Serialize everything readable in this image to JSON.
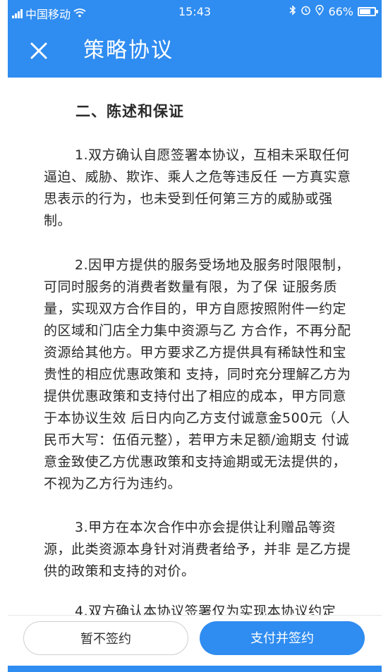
{
  "status_bar": {
    "carrier": "中国移动",
    "time": "15:43",
    "battery": "66%",
    "battery_level": 0.66,
    "icons": [
      "signal-icon",
      "wifi-icon",
      "bluetooth-icon",
      "alarm-icon",
      "location-icon",
      "battery-icon"
    ]
  },
  "nav": {
    "title": "策略协议",
    "close_icon": "close-icon"
  },
  "content": {
    "section_title": "二、陈述和保证",
    "paragraphs": [
      "1.双方确认自愿签署本协议，互相未采取任何逼迫、威胁、欺诈、乘人之危等违反任 一方真实意思表示的行为，也未受到任何第三方的威胁或强制。",
      "2.因甲方提供的服务受场地及服务时限限制，可同时服务的消费者数量有限，为了保 证服务质量，实现双方合作目的，甲方自愿按照附件一约定的区域和门店全力集中资源与乙 方合作，不再分配资源给其他方。甲方要求乙方提供具有稀缺性和宝贵性的相应优惠政策和 支持，同时充分理解乙方为提供优惠政策和支持付出了相应的成本，甲方同意于本协议生效 后日内向乙方支付诚意金500元（人民币大写：伍佰元整），若甲方未足额/逾期支 付诚意金致使乙方优惠政策和支持逾期或无法提供的，不视为乙方行为违约。",
      "3.甲方在本次合作中亦会提供让利赠品等资源，此类资源本身针对消费者给予，并非 是乙方提供的政策和支持的对价。",
      "4.双方确认本协议签署仅为实现本协议约定"
    ]
  },
  "actions": {
    "decline_label": "暂不签约",
    "pay_label": "支付并签约"
  },
  "colors": {
    "primary": "#2f8cf0",
    "text": "#2a2a2a",
    "background": "#ffffff"
  }
}
